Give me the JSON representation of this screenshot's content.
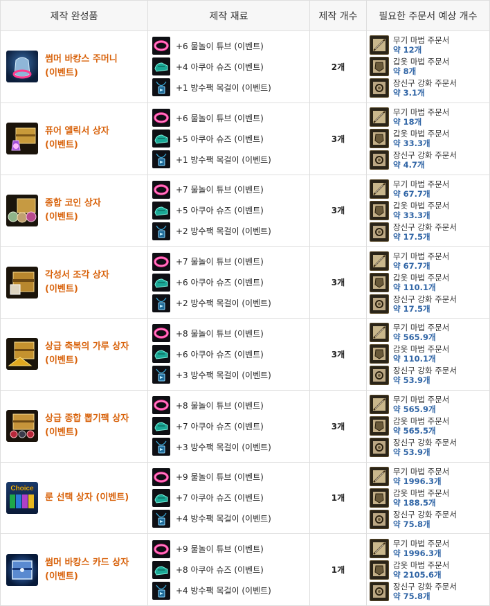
{
  "header": {
    "product": "제작 완성품",
    "materials": "제작 재료",
    "count": "제작 개수",
    "scrolls": "필요한 주문서 예상 개수"
  },
  "rows": [
    {
      "product": "썸머 바캉스 주머니\n(이벤트)",
      "product_icon": "pouch-icon",
      "materials": [
        "+6 물놀이 튜브 (이벤트)",
        "+4 아쿠아 슈즈 (이벤트)",
        "+1 방수팩 목걸이 (이벤트)"
      ],
      "count": "2개",
      "scrolls": [
        {
          "name": "무기 마법 주문서",
          "amount": "약 12개"
        },
        {
          "name": "갑옷 마법 주문서",
          "amount": "약 8개"
        },
        {
          "name": "장신구 강화 주문서",
          "amount": "약 3.1개"
        }
      ]
    },
    {
      "product": "퓨어 엘릭서 상자\n(이벤트)",
      "product_icon": "elixir-box-icon",
      "materials": [
        "+6 물놀이 튜브 (이벤트)",
        "+5 아쿠아 슈즈 (이벤트)",
        "+1 방수팩 목걸이 (이벤트)"
      ],
      "count": "3개",
      "scrolls": [
        {
          "name": "무기 마법 주문서",
          "amount": "약 18개"
        },
        {
          "name": "갑옷 마법 주문서",
          "amount": "약 33.3개"
        },
        {
          "name": "장신구 강화 주문서",
          "amount": "약 4.7개"
        }
      ]
    },
    {
      "product": "종합 코인 상자\n(이벤트)",
      "product_icon": "coin-box-icon",
      "materials": [
        "+7 물놀이 튜브 (이벤트)",
        "+5 아쿠아 슈즈 (이벤트)",
        "+2 방수팩 목걸이 (이벤트)"
      ],
      "count": "3개",
      "scrolls": [
        {
          "name": "무기 마법 주문서",
          "amount": "약 67.7개"
        },
        {
          "name": "갑옷 마법 주문서",
          "amount": "약 33.3개"
        },
        {
          "name": "장신구 강화 주문서",
          "amount": "약 17.5개"
        }
      ]
    },
    {
      "product": "각성서 조각 상자\n(이벤트)",
      "product_icon": "awakening-box-icon",
      "materials": [
        "+7 물놀이 튜브 (이벤트)",
        "+6 아쿠아 슈즈 (이벤트)",
        "+2 방수팩 목걸이 (이벤트)"
      ],
      "count": "3개",
      "scrolls": [
        {
          "name": "무기 마법 주문서",
          "amount": "약 67.7개"
        },
        {
          "name": "갑옷 마법 주문서",
          "amount": "약 110.1개"
        },
        {
          "name": "장신구 강화 주문서",
          "amount": "약 17.5개"
        }
      ]
    },
    {
      "product": "상급 축복의 가루 상자\n(이벤트)",
      "product_icon": "blessing-powder-box-icon",
      "materials": [
        "+8 물놀이 튜브 (이벤트)",
        "+6 아쿠아 슈즈 (이벤트)",
        "+3 방수팩 목걸이 (이벤트)"
      ],
      "count": "3개",
      "scrolls": [
        {
          "name": "무기 마법 주문서",
          "amount": "약 565.9개"
        },
        {
          "name": "갑옷 마법 주문서",
          "amount": "약 110.1개"
        },
        {
          "name": "장신구 강화 주문서",
          "amount": "약 53.9개"
        }
      ]
    },
    {
      "product": "상급 종합 뽑기팩 상자\n(이벤트)",
      "product_icon": "draw-pack-box-icon",
      "materials": [
        "+8 물놀이 튜브 (이벤트)",
        "+7 아쿠아 슈즈 (이벤트)",
        "+3 방수팩 목걸이 (이벤트)"
      ],
      "count": "3개",
      "scrolls": [
        {
          "name": "무기 마법 주문서",
          "amount": "약 565.9개"
        },
        {
          "name": "갑옷 마법 주문서",
          "amount": "약 565.5개"
        },
        {
          "name": "장신구 강화 주문서",
          "amount": "약 53.9개"
        }
      ]
    },
    {
      "product": "룬 선택 상자 (이벤트)",
      "product_icon": "rune-choice-box-icon",
      "product_icon_text": "Choice",
      "materials": [
        "+9 물놀이 튜브 (이벤트)",
        "+7 아쿠아 슈즈 (이벤트)",
        "+4 방수팩 목걸이 (이벤트)"
      ],
      "count": "1개",
      "scrolls": [
        {
          "name": "무기 마법 주문서",
          "amount": "약 1996.3개"
        },
        {
          "name": "갑옷 마법 주문서",
          "amount": "약 188.5개"
        },
        {
          "name": "장신구 강화 주문서",
          "amount": "약 75.8개"
        }
      ]
    },
    {
      "product": "썸머 바캉스 카드 상자\n(이벤트)",
      "product_icon": "card-box-icon",
      "materials": [
        "+9 물놀이 튜브 (이벤트)",
        "+8 아쿠아 슈즈 (이벤트)",
        "+4 방수팩 목걸이 (이벤트)"
      ],
      "count": "1개",
      "scrolls": [
        {
          "name": "무기 마법 주문서",
          "amount": "약 1996.3개"
        },
        {
          "name": "갑옷 마법 주문서",
          "amount": "약 2105.6개"
        },
        {
          "name": "장신구 강화 주문서",
          "amount": "약 75.8개"
        }
      ]
    }
  ],
  "material_icons": [
    "swim-tube-icon",
    "aqua-shoes-icon",
    "waterproof-necklace-icon"
  ],
  "scroll_icons": [
    "weapon-scroll-icon",
    "armor-scroll-icon",
    "accessory-scroll-icon"
  ],
  "colors": {
    "product_name": "#d8620b",
    "amount": "#2f64a5",
    "header_bg": "#f7f7f7",
    "border": "#dedede"
  }
}
